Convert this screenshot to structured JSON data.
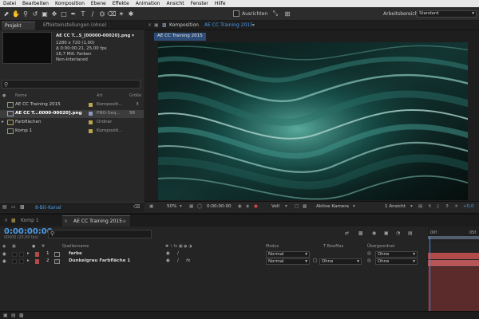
{
  "menu": [
    "Datei",
    "Bearbeiten",
    "Komposition",
    "Ebene",
    "Effekte",
    "Animation",
    "Ansicht",
    "Fenster",
    "Hilfe"
  ],
  "toolbar": {
    "snap_label": "Ausrichten",
    "workspace_label": "Arbeitsbereich:",
    "workspace_value": "Standard"
  },
  "project": {
    "tab_project": "Projekt",
    "tab_effects": "Effekteinstellungen (ohne)",
    "selected": {
      "name": "AE CC T...S_[00000-00020].png ▾",
      "info": [
        "1280 x 720 (1,00)",
        "Δ 0:00:00:21, 25,00 fps",
        "16,7 Mill. Farben",
        "Non-Interlaced"
      ]
    },
    "search_placeholder": "",
    "columns": {
      "name": "Name",
      "type": "Art",
      "size": "Größe"
    },
    "items": [
      {
        "name": "AE CC Training 2015",
        "type": "Kompositi...",
        "size": "",
        "swatch": "#b9a54c",
        "selected": false,
        "icon": "composition-icon"
      },
      {
        "name": "AE CC T...0000-00020].png",
        "type": "PNG-Seq...",
        "size": "56",
        "swatch": "#8e9ac4",
        "selected": true,
        "icon": "footage-icon"
      },
      {
        "name": "Farbflächen",
        "type": "Ordner",
        "size": "",
        "swatch": "#b9a54c",
        "selected": false,
        "icon": "folder-icon"
      },
      {
        "name": "Komp 1",
        "type": "Kompositi...",
        "size": "",
        "swatch": "#b9a54c",
        "selected": false,
        "icon": "composition-icon"
      }
    ],
    "bitdepth": "8-Bit-Kanal"
  },
  "composition": {
    "tab_label": "Komposition",
    "tab_name": "AE CC Training 2015",
    "subtab": "AE CC Training 2015",
    "zoom": "50%",
    "timecode": "0:00:00:00",
    "resolution": "Voll",
    "camera": "Aktive Kamera",
    "views": "1 Ansicht",
    "exposure": "+0,0"
  },
  "timeline": {
    "tabs": [
      "Komp 1",
      "AE CC Training 2015"
    ],
    "timecode": "0:00:00:00",
    "fps": "00000 (25,00 fps)",
    "columns": {
      "source": "Quellenname",
      "mode": "Modus",
      "trkmat": "T BewMas",
      "parent": "Übergeordnet"
    },
    "layers": [
      {
        "num": "1",
        "name": "farbe",
        "color": "#b24a4a",
        "mode": "Normal",
        "trkmat": "",
        "parent": "Ohne"
      },
      {
        "num": "2",
        "name": "Dunkelgrau Farbfläche 1",
        "color": "#7a7a7a",
        "mode": "Normal",
        "trkmat": "Ohne",
        "parent": "Ohne"
      }
    ],
    "ruler_start": "00f",
    "ruler_end": "05f"
  },
  "colors": {
    "accent": "#4a9ce8",
    "layer_track": "#b24a4a"
  }
}
